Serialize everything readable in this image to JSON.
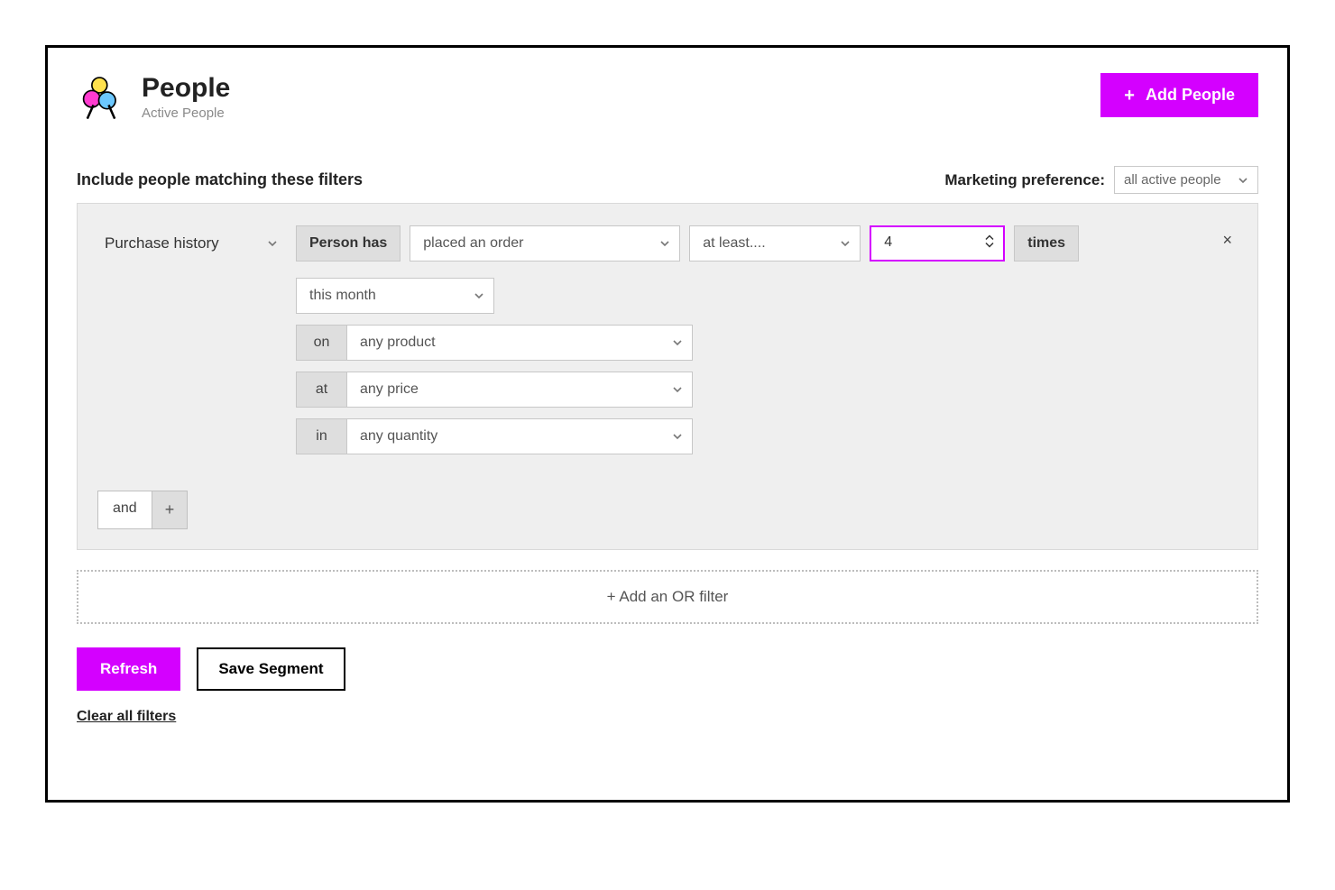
{
  "header": {
    "title": "People",
    "subtitle": "Active People",
    "add_button": "Add People"
  },
  "filters": {
    "heading": "Include people matching these filters",
    "pref_label": "Marketing preference:",
    "pref_value": "all active people",
    "category": "Purchase history",
    "person_has_label": "Person has",
    "action_value": "placed an order",
    "compare_value": "at least....",
    "count_value": "4",
    "times_label": "times",
    "timeframe_value": "this month",
    "rows": [
      {
        "label": "on",
        "value": "any product"
      },
      {
        "label": "at",
        "value": "any price"
      },
      {
        "label": "in",
        "value": "any quantity"
      }
    ],
    "and_label": "and",
    "and_plus": "+",
    "or_label": "+  Add an OR filter"
  },
  "actions": {
    "refresh": "Refresh",
    "save": "Save Segment",
    "clear": "Clear all filters"
  },
  "colors": {
    "accent": "#d400ff"
  }
}
